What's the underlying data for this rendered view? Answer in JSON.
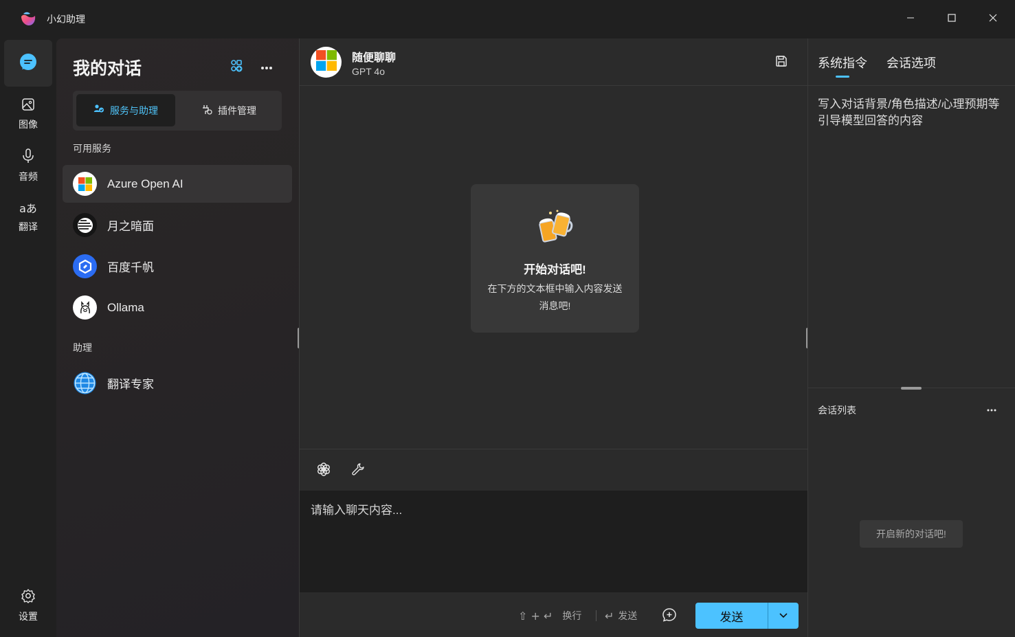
{
  "window": {
    "title": "小幻助理"
  },
  "nav": {
    "items": [
      {
        "label": "",
        "icon": "chat-icon"
      },
      {
        "label": "图像",
        "icon": "image-icon"
      },
      {
        "label": "音频",
        "icon": "microphone-icon"
      },
      {
        "label": "翻译",
        "icon": "translate-icon"
      }
    ],
    "settings_label": "设置"
  },
  "sidebar": {
    "title": "我的对话",
    "segments": {
      "services": "服务与助理",
      "plugins": "插件管理"
    },
    "services_label": "可用服务",
    "services": [
      {
        "name": "Azure Open AI",
        "icon": "microsoft-logo-icon"
      },
      {
        "name": "月之暗面",
        "icon": "moonshot-logo-icon"
      },
      {
        "name": "百度千帆",
        "icon": "baidu-qianfan-logo-icon"
      },
      {
        "name": "Ollama",
        "icon": "ollama-logo-icon"
      }
    ],
    "assistants_label": "助理",
    "assistants": [
      {
        "name": "翻译专家",
        "icon": "globe-icon"
      }
    ]
  },
  "chat": {
    "title": "随便聊聊",
    "model": "GPT 4o",
    "empty_title": "开始对话吧!",
    "empty_desc": "在下方的文本框中输入内容发送消息吧!",
    "input_placeholder": "请输入聊天内容...",
    "hint_newline_keys": "⇧ + ↵",
    "hint_newline_label": "换行",
    "hint_send_key": "↵",
    "hint_send_label": "发送",
    "send_label": "发送"
  },
  "right_panel": {
    "tabs": [
      "系统指令",
      "会话选项"
    ],
    "active_tab": 0,
    "system_prompt_placeholder": "写入对话背景/角色描述/心理预期等引导模型回答的内容",
    "list_title": "会话列表",
    "new_conversation": "开启新的对话吧!"
  },
  "colors": {
    "accent": "#4cc2ff",
    "background": "#202020",
    "panel": "#2b2b2b"
  }
}
